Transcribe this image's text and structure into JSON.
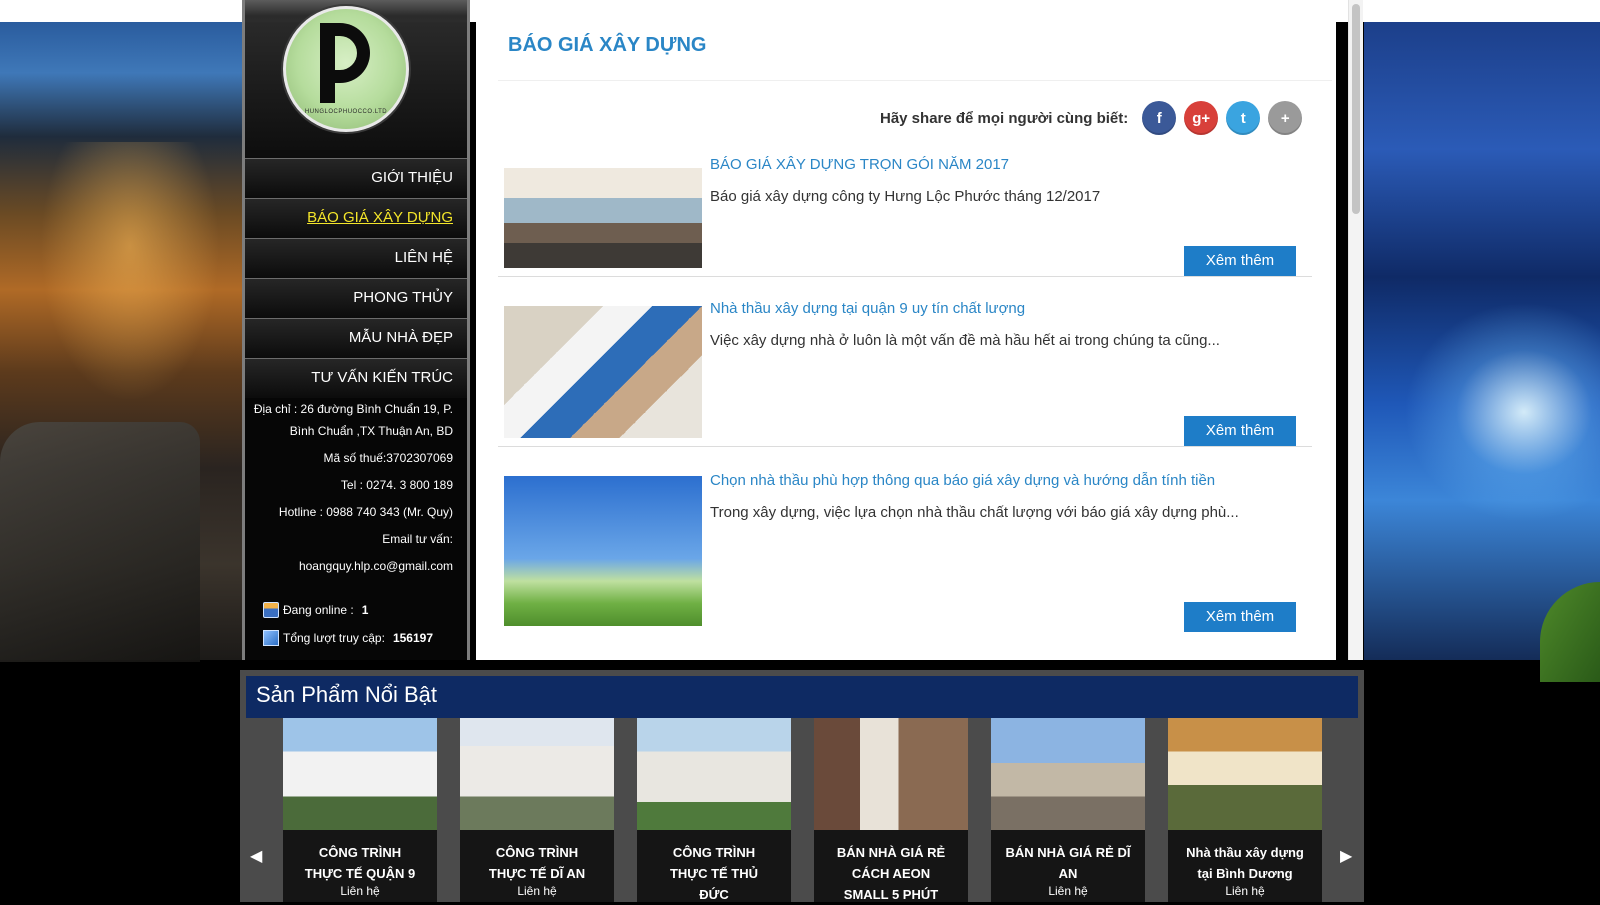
{
  "sidebar": {
    "logo_ring_text": "HUNGLOCPHUOCCO.LTD",
    "menu": [
      {
        "label": "GIỚI THIỆU",
        "active": false
      },
      {
        "label": "BÁO GIÁ XÂY DỰNG",
        "active": true
      },
      {
        "label": "LIÊN HỆ",
        "active": false
      },
      {
        "label": "PHONG THỦY",
        "active": false
      },
      {
        "label": "MẪU NHÀ ĐẸP",
        "active": false
      },
      {
        "label": "TƯ VẤN KIẾN TRÚC",
        "active": false
      }
    ],
    "contact": {
      "address_line1": "Địa chỉ : 26 đường Bình Chuẩn 19, P.",
      "address_line2": "Bình Chuẩn ,TX Thuận An, BD",
      "tax": "Mã số thuế:3702307069",
      "tel": "Tel : 0274. 3 800 189",
      "hotline": "Hotline : 0988 740 343 (Mr. Quy)",
      "email_label": "Email tư vấn:",
      "email": "hoangquy.hlp.co@gmail.com"
    },
    "stats": {
      "online_label": "Đang online :",
      "online_value": "1",
      "visits_label": "Tổng lượt truy cập:",
      "visits_value": "156197"
    }
  },
  "main": {
    "page_title": "BÁO GIÁ XÂY DỰNG",
    "share_label": "Hãy share để mọi người cùng biết:",
    "share_buttons": [
      {
        "icon": "facebook-icon",
        "glyph": "f",
        "color": "#3b5998"
      },
      {
        "icon": "google-plus-icon",
        "glyph": "g+",
        "color": "#d8403a"
      },
      {
        "icon": "twitter-icon",
        "glyph": "t",
        "color": "#3aa4e0"
      },
      {
        "icon": "share-more-icon",
        "glyph": "+",
        "color": "#9a9a9a"
      }
    ],
    "more_label": "Xêm thêm",
    "posts": [
      {
        "title": "BÁO GIÁ XÂY DỰNG TRỌN GÓI NĂM 2017",
        "desc": "Báo giá xây dựng công ty Hưng Lộc Phước tháng 12/2017"
      },
      {
        "title": "Nhà thầu xây dựng tại quận 9 uy tín chất lượng",
        "desc": "Việc xây dựng nhà ở luôn là một vấn đề mà hầu hết ai trong chúng ta cũng..."
      },
      {
        "title": "Chọn nhà thầu phù hợp thông qua báo giá xây dựng và hướng dẫn tính tiền",
        "desc": "Trong xây dựng, việc lựa chọn nhà thầu chất lượng với báo giá xây dựng phù..."
      }
    ]
  },
  "featured": {
    "heading": "Sản Phẩm Nổi Bật",
    "prev_glyph": "◀",
    "next_glyph": "▶",
    "items": [
      {
        "line1": "CÔNG TRÌNH",
        "line2": "THỰC TẾ QUẬN 9",
        "line3": "",
        "sub": "Liên hệ"
      },
      {
        "line1": "CÔNG TRÌNH",
        "line2": "THỰC TẾ DĨ AN",
        "line3": "",
        "sub": "Liên hệ"
      },
      {
        "line1": "CÔNG TRÌNH",
        "line2": "THỰC TẾ THỦ",
        "line3": "ĐỨC",
        "sub": ""
      },
      {
        "line1": "BÁN NHÀ GIÁ RẺ",
        "line2": "CÁCH AEON",
        "line3": "SMALL 5 PHÚT",
        "sub": ""
      },
      {
        "line1": "BÁN NHÀ GIÁ RẺ DĨ",
        "line2": "AN",
        "line3": "",
        "sub": "Liên hệ"
      },
      {
        "line1": "Nhà thầu xây dựng",
        "line2": "tại Bình Dương",
        "line3": "",
        "sub": "Liên hệ"
      }
    ]
  }
}
